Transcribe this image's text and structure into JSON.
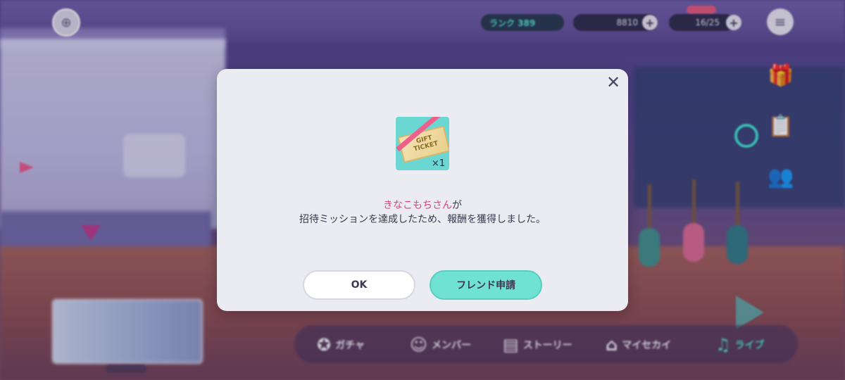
{
  "topbar": {
    "rank_label": "ランク 389",
    "crystals": "8810",
    "energy": "16/25"
  },
  "nav": {
    "items": [
      {
        "label": "ガチャ",
        "icon": "gacha-icon"
      },
      {
        "label": "メンバー",
        "icon": "member-icon"
      },
      {
        "label": "ストーリー",
        "icon": "story-icon"
      },
      {
        "label": "マイセカイ",
        "icon": "mysekai-icon"
      },
      {
        "label": "ライブ",
        "icon": "live-icon",
        "active": true
      }
    ]
  },
  "dialog": {
    "close_icon": "close-icon",
    "reward": {
      "ticket_line1": "GIFT",
      "ticket_line2": "TICKET",
      "quantity": "×1"
    },
    "friend_name": "きなこもちさん",
    "name_suffix": "が",
    "message_line2": "招待ミッションを達成したため、報酬を獲得しました。",
    "ok_label": "OK",
    "friend_request_label": "フレンド申請"
  },
  "colors": {
    "accent_teal": "#6fe2d3",
    "name_pink": "#e0427a",
    "dialog_bg": "#ebebf2"
  }
}
